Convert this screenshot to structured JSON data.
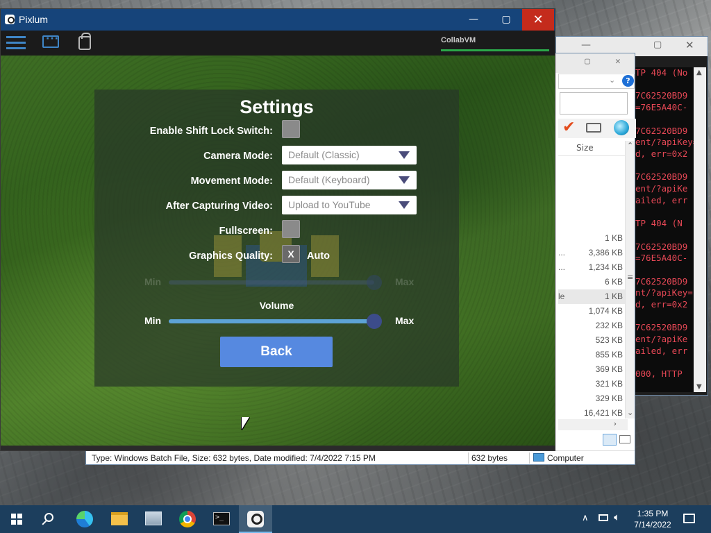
{
  "desktop": {
    "background": "granite cliff"
  },
  "explorer": {
    "column_size": "Size",
    "file_sizes": [
      {
        "pre": "",
        "size": "1 KB"
      },
      {
        "pre": "...",
        "size": "3,386 KB"
      },
      {
        "pre": "...",
        "size": "1,234 KB"
      },
      {
        "pre": "",
        "size": "6 KB"
      },
      {
        "pre": "le",
        "size": "1 KB",
        "selected": true
      },
      {
        "pre": "",
        "size": "1,074 KB"
      },
      {
        "pre": "",
        "size": "232 KB"
      },
      {
        "pre": "",
        "size": "523 KB"
      },
      {
        "pre": "",
        "size": "855 KB"
      },
      {
        "pre": "",
        "size": "369 KB"
      },
      {
        "pre": "",
        "size": "321 KB"
      },
      {
        "pre": "",
        "size": "329 KB"
      },
      {
        "pre": "",
        "size": "16,421 KB"
      }
    ],
    "status_left": "Type: Windows Batch File, Size: 632 bytes, Date modified: 7/4/2022 7:15 PM",
    "status_mid": "632 bytes",
    "status_right": "Computer"
  },
  "terminal": {
    "lines": [
      "TP 404 (No",
      "",
      "7C62520BD9",
      "=76E5A40C-",
      "",
      "7C62520BD9",
      "ent/?apiKey=",
      "d, err=0x2",
      "",
      "7C62520BD9",
      "ent/?apiKe",
      "ailed, err",
      "",
      "TP 404 (N",
      "",
      "7C62520BD9",
      "=76E5A40C-",
      "",
      "7C62520BD9",
      "nt/?apiKey=",
      "d, err=0x2",
      "",
      "7C62520BD9",
      "ent/?apiKe",
      "ailed, err",
      "",
      "000, HTTP"
    ]
  },
  "pixlum": {
    "title": "Pixlum",
    "collab_label": "CollabVM",
    "settings": {
      "title": "Settings",
      "shift_lock_label": "Enable Shift Lock Switch:",
      "camera_label": "Camera Mode:",
      "camera_value": "Default (Classic)",
      "movement_label": "Movement Mode:",
      "movement_value": "Default (Keyboard)",
      "capture_label": "After Capturing Video:",
      "capture_value": "Upload to YouTube",
      "fullscreen_label": "Fullscreen:",
      "graphics_label": "Graphics Quality:",
      "graphics_check": "X",
      "graphics_auto": "Auto",
      "graphics_min": "Min",
      "graphics_max": "Max",
      "volume_label": "Volume",
      "volume_min": "Min",
      "volume_max": "Max",
      "volume_level": 1.0,
      "back_label": "Back"
    }
  },
  "taskbar": {
    "time": "1:35 PM",
    "date": "7/14/2022",
    "active_app": "Pixlum"
  },
  "colors": {
    "titlebar": "#16447a",
    "back_button": "#5689e0",
    "slider_track": "#5da3d6",
    "slider_knob": "#3c4c8a",
    "close": "#c42b1c",
    "terminal_text": "#e74856"
  }
}
